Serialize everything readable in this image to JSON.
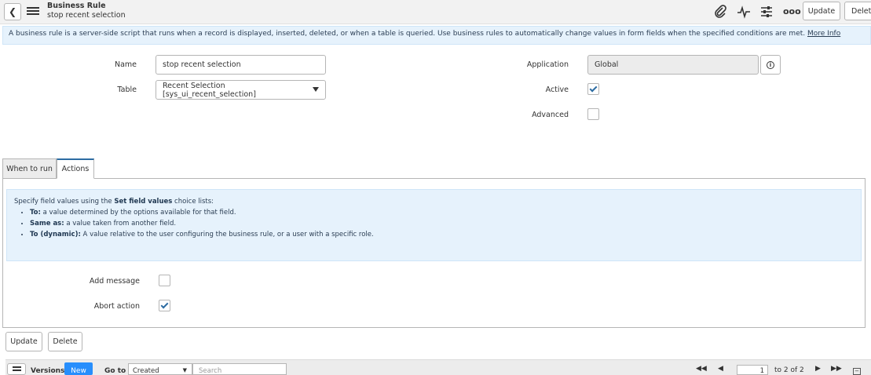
{
  "header": {
    "record_type": "Business Rule",
    "record_name": "stop recent selection",
    "update_label": "Update",
    "delete_label": "Delete",
    "more_label": "ooo"
  },
  "banner": {
    "text": "A business rule is a server-side script that runs when a record is displayed, inserted, deleted, or when a table is queried. Use business rules to automatically change values in form fields when the specified conditions are met.",
    "more_info": "More Info"
  },
  "form": {
    "name_label": "Name",
    "name_value": "stop recent selection",
    "table_label": "Table",
    "table_value": "Recent Selection [sys_ui_recent_selection]",
    "application_label": "Application",
    "application_value": "Global",
    "active_label": "Active",
    "active_checked": true,
    "advanced_label": "Advanced",
    "advanced_checked": false
  },
  "tabs": [
    {
      "label": "When to run",
      "active": false
    },
    {
      "label": "Actions",
      "active": true
    }
  ],
  "help": {
    "intro_prefix": "Specify field values using the ",
    "intro_bold": "Set field values",
    "intro_suffix": " choice lists:",
    "items": [
      {
        "bold": "To:",
        "text": " a value determined by the options available for that field."
      },
      {
        "bold": "Same as:",
        "text": " a value taken from another field."
      },
      {
        "bold": "To (dynamic):",
        "text": " A value relative to the user configuring the business rule, or a user with a specific role."
      }
    ]
  },
  "actions": {
    "add_message_label": "Add message",
    "add_message_checked": false,
    "abort_action_label": "Abort action",
    "abort_action_checked": true
  },
  "bottom_buttons": {
    "update_label": "Update",
    "delete_label": "Delete"
  },
  "related_list": {
    "versions_label": "Versions",
    "new_label": "New",
    "goto_label": "Go to",
    "goto_value": "Created",
    "search_placeholder": "Search",
    "page_value": "1",
    "page_range": "to 2 of 2"
  },
  "colors": {
    "accent": "#2d6ca2",
    "new_button": "#278efc",
    "banner_bg": "#e6f2fc"
  }
}
